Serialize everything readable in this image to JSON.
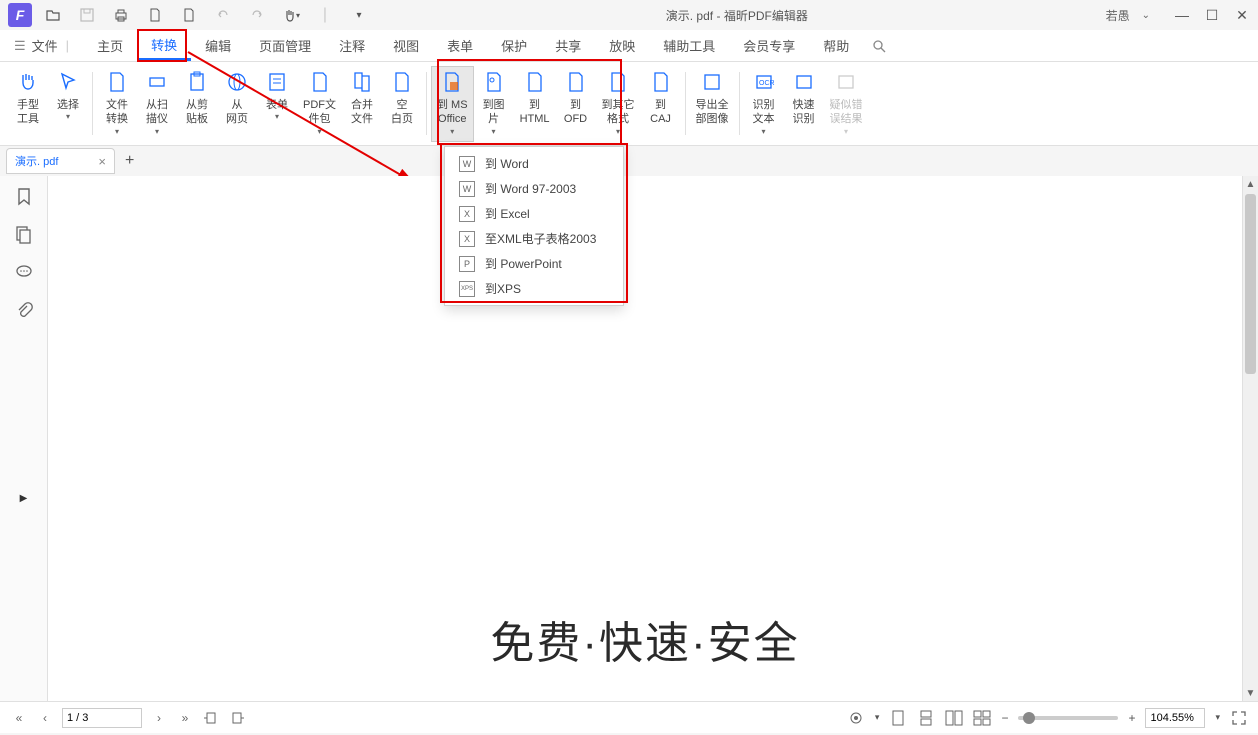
{
  "title": {
    "doc": "演示. pdf",
    "app": "福昕PDF编辑器"
  },
  "user_name": "若愚",
  "menubar": {
    "file": "文件",
    "items": [
      "主页",
      "转换",
      "编辑",
      "页面管理",
      "注释",
      "视图",
      "表单",
      "保护",
      "共享",
      "放映",
      "辅助工具",
      "会员专享",
      "帮助"
    ],
    "active_index": 1
  },
  "ribbon": {
    "hand": "手型\n工具",
    "select": "选择",
    "file_convert": "文件\n转换",
    "from_scanner": "从扫\n描仪",
    "from_clipboard": "从剪\n贴板",
    "from_web": "从\n网页",
    "form": "表单",
    "pdf_package": "PDF文\n件包",
    "merge": "合并\n文件",
    "blank": "空\n白页",
    "to_office": "到 MS\nOffice",
    "to_image": "到图\n片",
    "to_html": "到\nHTML",
    "to_ofd": "到\nOFD",
    "to_other": "到其它\n格式",
    "to_caj": "到\nCAJ",
    "export_images": "导出全\n部图像",
    "ocr_text": "识别\n文本",
    "quick_ocr": "快速\n识别",
    "ocr_suspect": "疑似错\n误结果"
  },
  "dropdown": {
    "word": "到 Word",
    "word97": "到 Word 97-2003",
    "excel": "到 Excel",
    "xml2003": "至XML电子表格2003",
    "ppt": "到 PowerPoint",
    "xps": "到XPS"
  },
  "tabs": {
    "doc_tab": "演示. pdf"
  },
  "page": {
    "content_text": "免费·快速·安全"
  },
  "status": {
    "page": "1 / 3",
    "zoom": "104.55%"
  },
  "icons": {
    "w": "W",
    "x": "X",
    "p": "P",
    "xps": "XPS"
  }
}
